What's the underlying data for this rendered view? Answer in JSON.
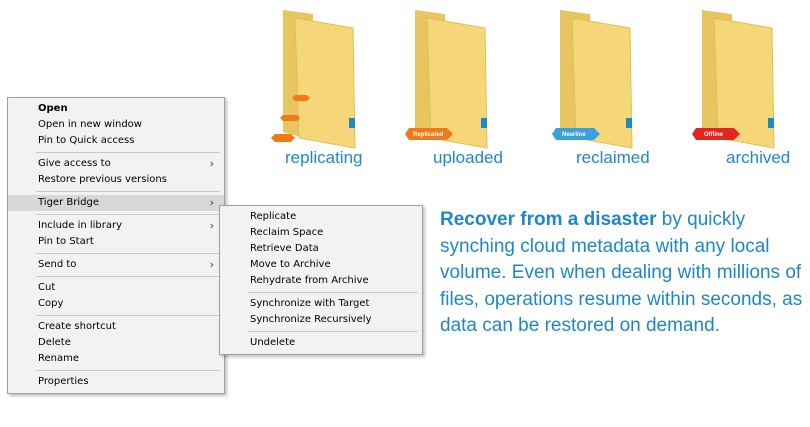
{
  "folders": [
    {
      "caption": "replicating",
      "tag": "",
      "tag_color": "#f07a1a"
    },
    {
      "caption": "uploaded",
      "tag": "Replicated",
      "tag_color": "#f07a1a"
    },
    {
      "caption": "reclaimed",
      "tag": "Nearline",
      "tag_color": "#3aa0dc"
    },
    {
      "caption": "archived",
      "tag": "Offline",
      "tag_color": "#e3261f"
    }
  ],
  "context_menu": {
    "items": [
      {
        "label": "Open"
      },
      {
        "label": "Open in new window"
      },
      {
        "label": "Pin to Quick access"
      },
      {
        "label": "Give access to"
      },
      {
        "label": "Restore previous versions"
      },
      {
        "label": "Tiger Bridge"
      },
      {
        "label": "Include in library"
      },
      {
        "label": "Pin to Start"
      },
      {
        "label": "Send to"
      },
      {
        "label": "Cut"
      },
      {
        "label": "Copy"
      },
      {
        "label": "Create shortcut"
      },
      {
        "label": "Delete"
      },
      {
        "label": "Rename"
      },
      {
        "label": "Properties"
      }
    ]
  },
  "submenu": {
    "items": [
      {
        "label": "Replicate"
      },
      {
        "label": "Reclaim Space"
      },
      {
        "label": "Retrieve Data"
      },
      {
        "label": "Move to Archive"
      },
      {
        "label": "Rehydrate from Archive"
      },
      {
        "label": "Synchronize with Target"
      },
      {
        "label": "Synchronize Recursively"
      },
      {
        "label": "Undelete"
      }
    ]
  },
  "description": {
    "bold": "Recover from a disaster",
    "rest": " by quickly synching cloud metadata with any local volume. Even when dealing with millions of files, operations resume within seconds, as data can be restored on demand."
  },
  "colors": {
    "accent": "#1e88c7",
    "folder": "#f5d77a",
    "menu_bg": "#f2f2f2",
    "highlight": "#d8d8d8"
  }
}
